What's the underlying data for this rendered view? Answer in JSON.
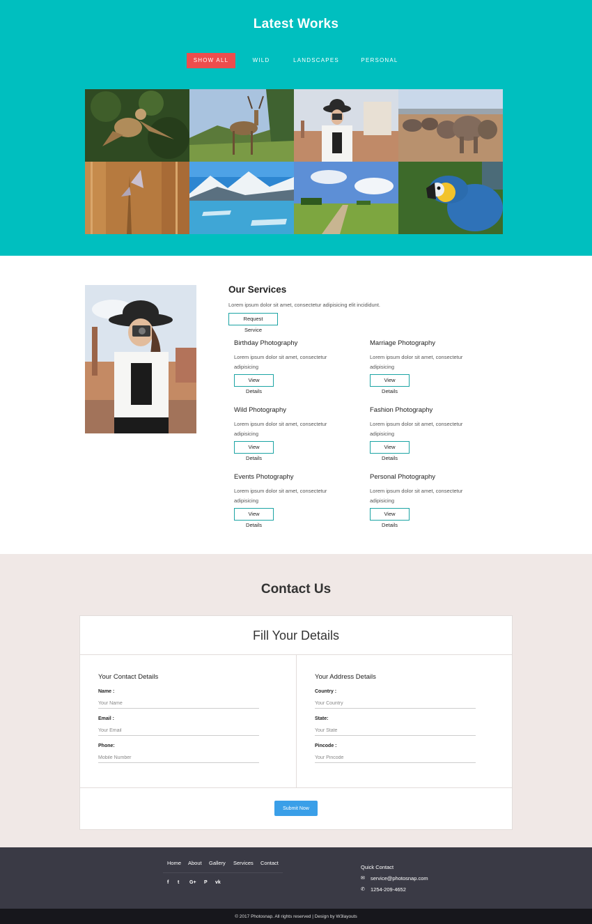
{
  "works": {
    "title": "Latest Works",
    "filters": [
      "SHOW ALL",
      "WILD",
      "LANDSCAPES",
      "PERSONAL"
    ],
    "active_filter": "SHOW ALL",
    "colors": {
      "background": "#00bfbf",
      "active": "#ee4d4d"
    }
  },
  "services": {
    "title": "Our Services",
    "intro": "Lorem ipsum dolor sit amet, consectetur adipisicing elit incididunt.",
    "request_label": "Request Service",
    "items": [
      {
        "title": "Birthday Photography",
        "line1": "Lorem ipsum dolor sit amet, consectetur",
        "line2": "adipisicing",
        "button": "View Details"
      },
      {
        "title": "Marriage Photography",
        "line1": "Lorem ipsum dolor sit amet, consectetur",
        "line2": "adipisicing",
        "button": "View Details"
      },
      {
        "title": "Wild Photography",
        "line1": "Lorem ipsum dolor sit amet, consectetur",
        "line2": "adipisicing",
        "button": "View Details"
      },
      {
        "title": "Fashion Photography",
        "line1": "Lorem ipsum dolor sit amet, consectetur",
        "line2": "adipisicing",
        "button": "View Details"
      },
      {
        "title": "Events Photography",
        "line1": "Lorem ipsum dolor sit amet, consectetur",
        "line2": "adipisicing",
        "button": "View Details"
      },
      {
        "title": "Personal Photography",
        "line1": "Lorem ipsum dolor sit amet, consectetur",
        "line2": "adipisicing",
        "button": "View Details"
      }
    ]
  },
  "contact": {
    "title": "Contact Us",
    "form_title": "Fill Your Details",
    "left_title": "Your Contact Details",
    "right_title": "Your Address Details",
    "left_fields": [
      {
        "label": "Name :",
        "placeholder": "Your Name"
      },
      {
        "label": "Email :",
        "placeholder": "Your Email"
      },
      {
        "label": "Phone:",
        "placeholder": "Mobile Number"
      }
    ],
    "right_fields": [
      {
        "label": "Country :",
        "placeholder": "Your Country"
      },
      {
        "label": "State:",
        "placeholder": "Your State"
      },
      {
        "label": "Pincode :",
        "placeholder": "Your Pincode"
      }
    ],
    "submit_label": "Submit Now"
  },
  "footer": {
    "nav": [
      "Home",
      "About",
      "Gallery",
      "Services",
      "Contact"
    ],
    "social": [
      "f",
      "t",
      "G+",
      "P",
      "vk"
    ],
    "social_icons": [
      "facebook-icon",
      "twitter-icon",
      "google-plus-icon",
      "pinterest-icon",
      "vk-icon"
    ],
    "quick_contact_title": "Quick Contact",
    "email": "service@photosnap.com",
    "phone": "1254-209-4652",
    "copyright": "© 2017 Photosnap. All rights reserved | Design by W3layouts"
  }
}
